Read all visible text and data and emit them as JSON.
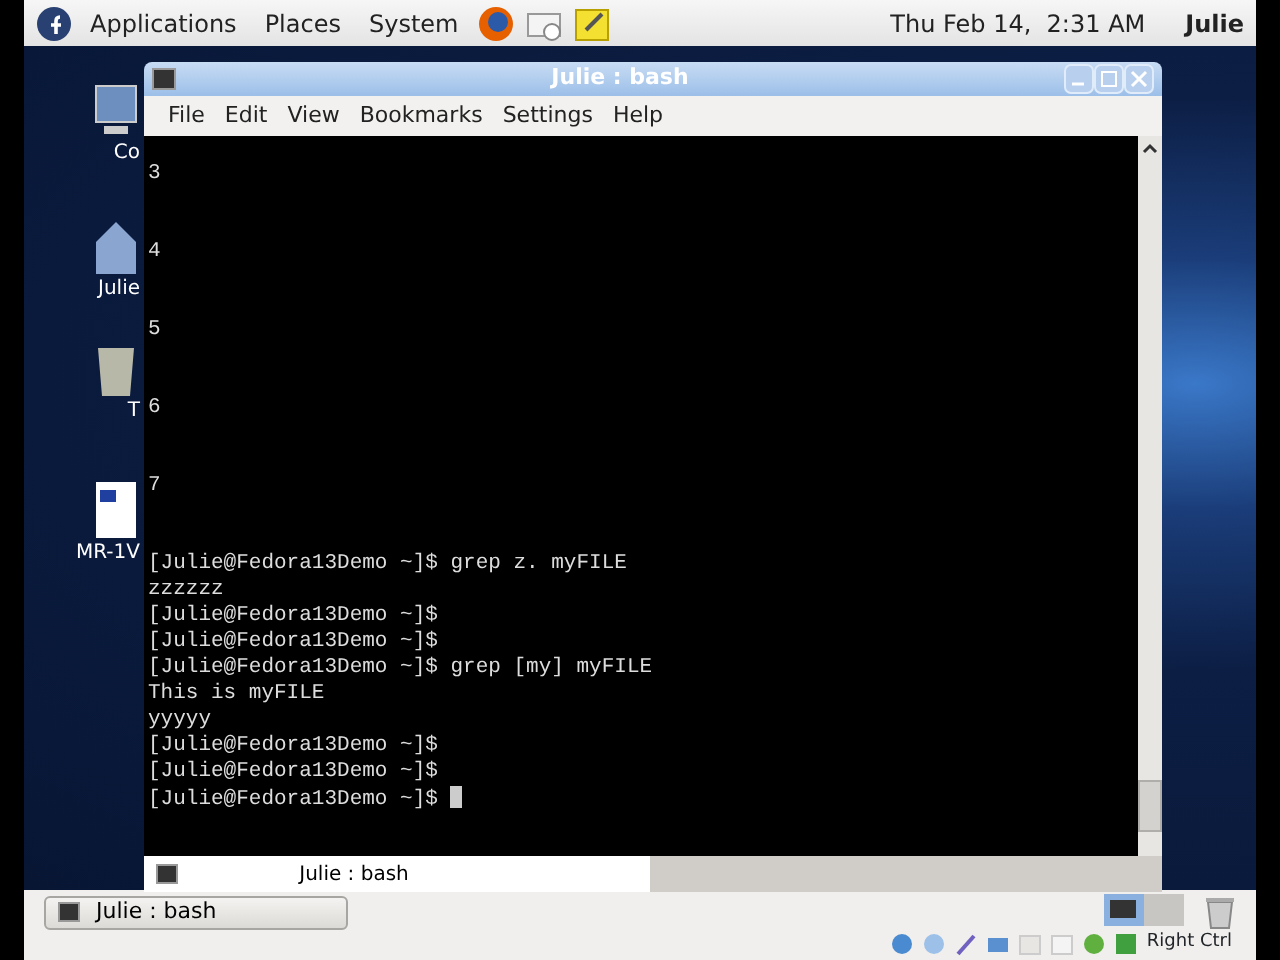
{
  "top_panel": {
    "menus": [
      "Applications",
      "Places",
      "System"
    ],
    "clock": "Thu Feb 14,  2:31 AM",
    "user": "Julie"
  },
  "desktop_icons": [
    {
      "label": "Co",
      "kind": "computer"
    },
    {
      "label": "Julie",
      "kind": "home"
    },
    {
      "label": "T",
      "kind": "trash"
    },
    {
      "label": "MR-1V",
      "kind": "document"
    }
  ],
  "window": {
    "title": "Julie : bash",
    "menu": [
      "File",
      "Edit",
      "View",
      "Bookmarks",
      "Settings",
      "Help"
    ],
    "terminal_lines": [
      {
        "text": "3",
        "kind": "number"
      },
      {
        "text": "4",
        "kind": "number"
      },
      {
        "text": "5",
        "kind": "number"
      },
      {
        "text": "6",
        "kind": "number"
      },
      {
        "text": "7",
        "kind": "number"
      },
      {
        "text": "[Julie@Fedora13Demo ~]$ grep z. myFILE",
        "kind": "prompt"
      },
      {
        "text": "zzzzzz",
        "kind": "output"
      },
      {
        "text": "[Julie@Fedora13Demo ~]$",
        "kind": "prompt"
      },
      {
        "text": "[Julie@Fedora13Demo ~]$",
        "kind": "prompt"
      },
      {
        "text": "[Julie@Fedora13Demo ~]$ grep [my] myFILE",
        "kind": "prompt"
      },
      {
        "text": "This is myFILE",
        "kind": "output"
      },
      {
        "text": "yyyyy",
        "kind": "output"
      },
      {
        "text": "[Julie@Fedora13Demo ~]$",
        "kind": "prompt"
      },
      {
        "text": "[Julie@Fedora13Demo ~]$",
        "kind": "prompt"
      },
      {
        "text": "[Julie@Fedora13Demo ~]$",
        "kind": "prompt",
        "cursor": true
      }
    ],
    "tabs": [
      {
        "label": "Julie : bash",
        "selected": true
      }
    ]
  },
  "taskbar": {
    "buttons": [
      {
        "label": "Julie : bash",
        "selected": false
      }
    ]
  },
  "vm_status": {
    "key_label": "Right Ctrl"
  }
}
